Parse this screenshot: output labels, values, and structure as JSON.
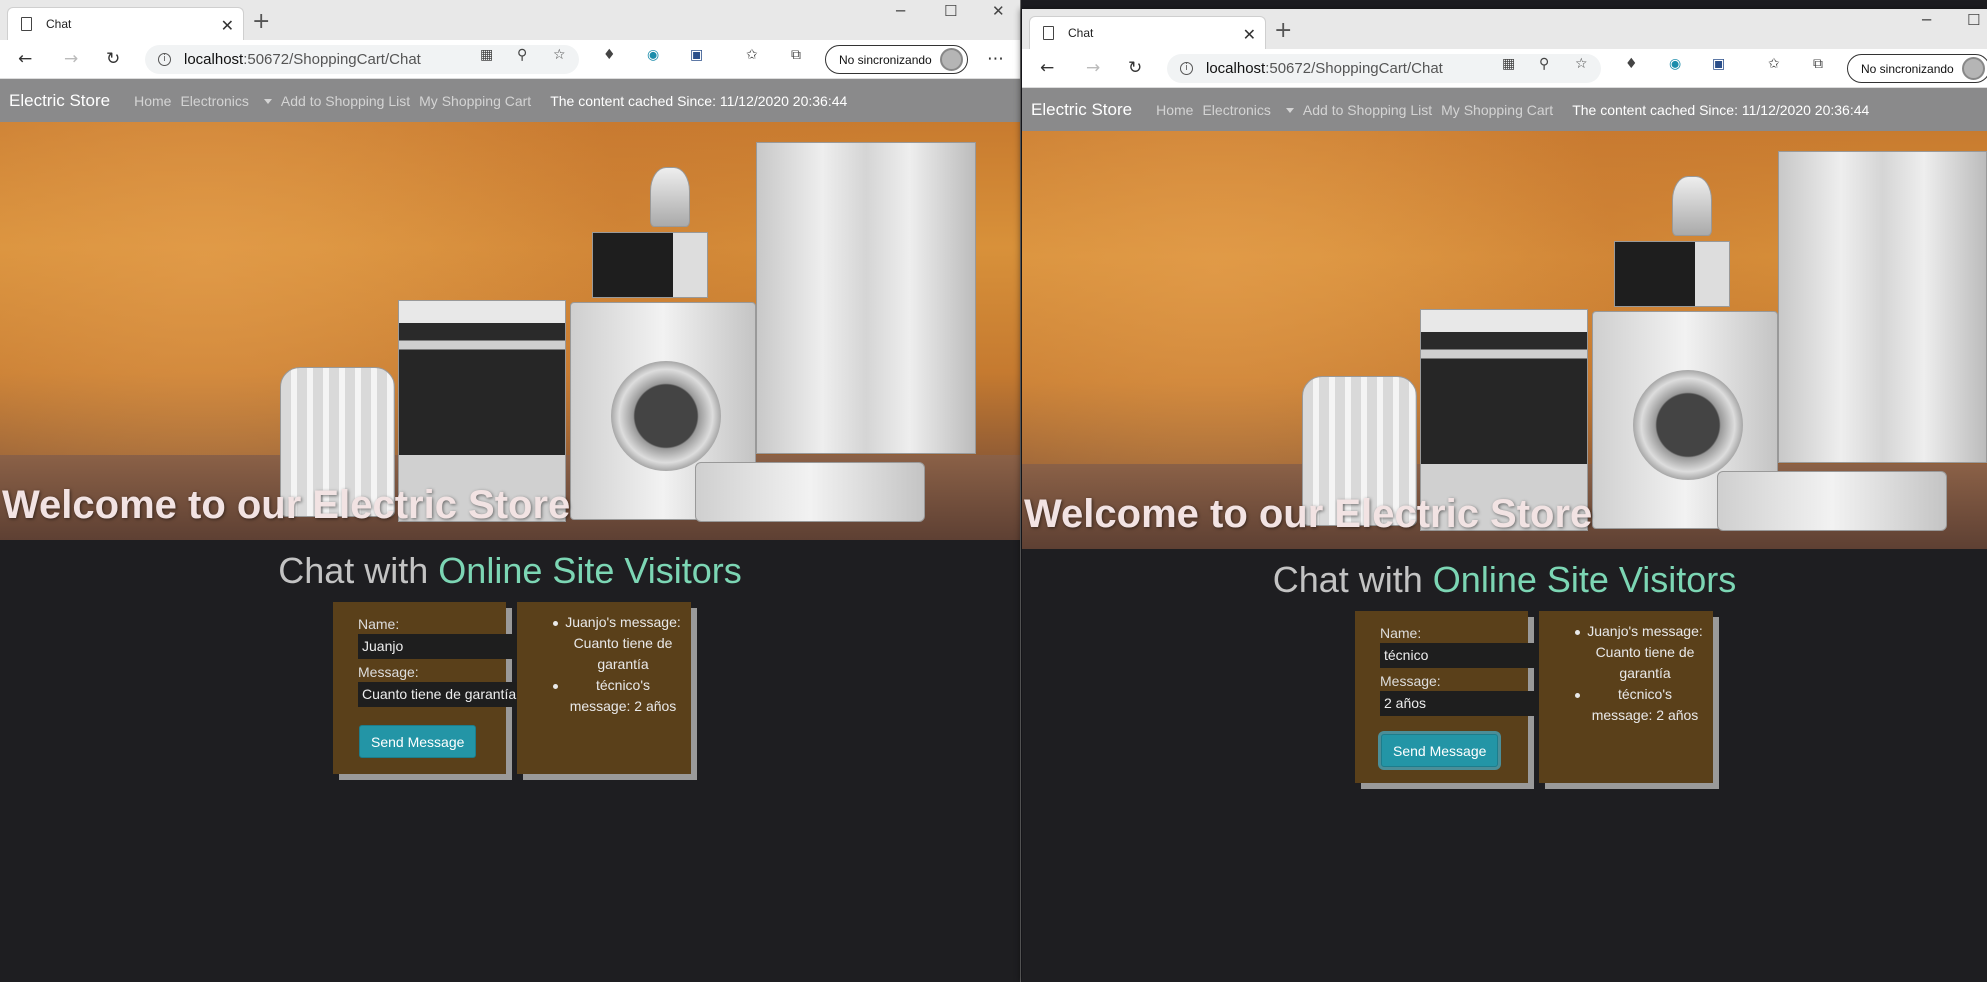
{
  "left_window": {
    "tab_title": "Chat",
    "url_host": "localhost",
    "url_path": ":50672/ShoppingCart/Chat",
    "sync_label": "No sincronizando",
    "site": {
      "brand": "Electric Store",
      "nav": [
        "Home",
        "Electronics",
        "Add to Shopping List",
        "My Shopping Cart"
      ],
      "cached": "The content cached Since: 11/12/2020 20:36:44",
      "hero_heading": "Welcome to our Electric Store",
      "chat_title_a": "Chat with ",
      "chat_title_b": "Online Site Visitors",
      "name_label": "Name:",
      "name_value": "Juanjo",
      "message_label": "Message:",
      "message_value": "Cuanto tiene de garantía",
      "send_label": "Send Message",
      "messages": [
        "Juanjo's message: Cuanto tiene de garantía",
        "técnico's message: 2 años"
      ]
    }
  },
  "right_window": {
    "tab_title": "Chat",
    "url_host": "localhost",
    "url_path": ":50672/ShoppingCart/Chat",
    "sync_label": "No sincronizando",
    "site": {
      "brand": "Electric Store",
      "nav": [
        "Home",
        "Electronics",
        "Add to Shopping List",
        "My Shopping Cart"
      ],
      "cached": "The content cached Since: 11/12/2020 20:36:44",
      "hero_heading": "Welcome to our Electric Store",
      "chat_title_a": "Chat with ",
      "chat_title_b": "Online Site Visitors",
      "name_label": "Name:",
      "name_value": "técnico",
      "message_label": "Message:",
      "message_value": "2 años",
      "send_label": "Send Message",
      "messages": [
        "Juanjo's message: Cuanto tiene de garantía",
        "técnico's message: 2 años"
      ]
    }
  },
  "icons": {
    "close": "✕",
    "new_tab": "+",
    "minimize": "─",
    "maximize": "☐",
    "back": "←",
    "forward": "→",
    "reload": "↻",
    "more": "⋯",
    "zoom": "⚲",
    "favorite": "☆",
    "favorites": "✩"
  },
  "colors": {
    "accent_teal": "#2395a6",
    "highlight_green": "#7cd6b4",
    "panel_brown": "#5a401a",
    "navbar_gray": "#8a8a8b"
  }
}
